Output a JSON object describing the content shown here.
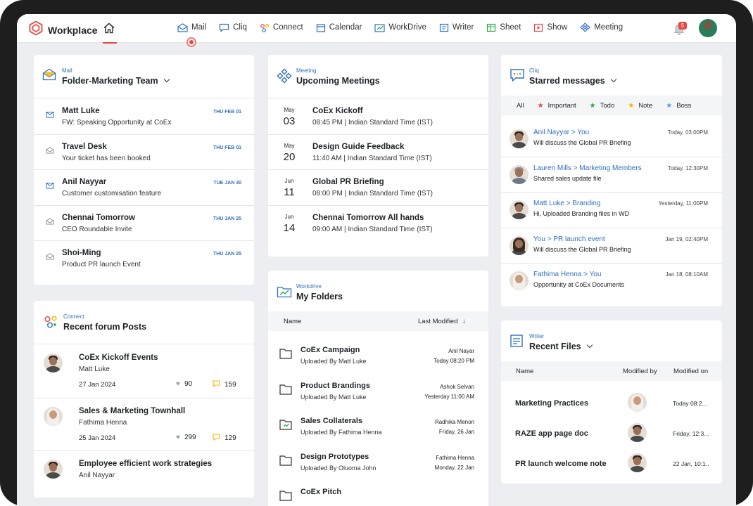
{
  "app": {
    "name": "Workplace",
    "notifications": "5"
  },
  "nav": {
    "items": [
      {
        "label": "Mail",
        "icon": "mail-icon"
      },
      {
        "label": "Cliq",
        "icon": "chat-icon"
      },
      {
        "label": "Connect",
        "icon": "connect-icon"
      },
      {
        "label": "Calendar",
        "icon": "calendar-icon"
      },
      {
        "label": "WorkDrive",
        "icon": "workdrive-icon"
      },
      {
        "label": "Writer",
        "icon": "writer-icon"
      },
      {
        "label": "Sheet",
        "icon": "sheet-icon"
      },
      {
        "label": "Show",
        "icon": "show-icon"
      },
      {
        "label": "Meeting",
        "icon": "meeting-icon"
      }
    ]
  },
  "mail": {
    "app_label": "Mail",
    "title": "Folder-Marketing Team",
    "items": [
      {
        "sender": "Matt Luke",
        "subject": "FW: Speaking Opportunity at CoEx",
        "date": "THU FEB 01",
        "read": false
      },
      {
        "sender": "Travel Desk",
        "subject": "Your ticket has been booked",
        "date": "THU FEB 01",
        "read": true
      },
      {
        "sender": "Anil Nayyar",
        "subject": "Customer customisation feature",
        "date": "TUE JAN 30",
        "read": false
      },
      {
        "sender": "Chennai Tomorrow",
        "subject": "CEO Roundable Invite",
        "date": "THU JAN 25",
        "read": true
      },
      {
        "sender": "Shoi-Ming",
        "subject": "Product PR launch Event",
        "date": "THU JAN 25",
        "read": true
      }
    ]
  },
  "meeting": {
    "app_label": "Meeting",
    "title": "Upcoming Meetings",
    "items": [
      {
        "month": "May",
        "day": "03",
        "title": "CoEx Kickoff",
        "time": "08:45 PM | Indian Standard Time (IST)"
      },
      {
        "month": "May",
        "day": "20",
        "title": "Design Guide Feedback",
        "time": "11:40 AM | Indian Standard Time (IST)"
      },
      {
        "month": "Jun",
        "day": "11",
        "title": "Global PR Briefing",
        "time": "08:00 PM | Indian Standard Time (IST)"
      },
      {
        "month": "Jun",
        "day": "14",
        "title": "Chennai Tomorrow All hands",
        "time": "09:00 AM | Indian Standard Time (IST)"
      }
    ]
  },
  "cliq": {
    "app_label": "Cliq",
    "title": "Starred messages",
    "filters": [
      {
        "label": "All",
        "color": ""
      },
      {
        "label": "Important",
        "color": "#e5483f"
      },
      {
        "label": "Todo",
        "color": "#2aa84a"
      },
      {
        "label": "Note",
        "color": "#f4b400"
      },
      {
        "label": "Boss",
        "color": "#4aa3e0"
      }
    ],
    "messages": [
      {
        "from": "Anil Nayyar > You",
        "text": "Will discuss the Global PR Briefing",
        "time": "Today, 03:00PM"
      },
      {
        "from": "Lauren Mills > Marketing Members",
        "text": "Shared sales update file",
        "time": "Today, 12:30PM"
      },
      {
        "from": "Matt Luke > Branding",
        "text": "Hi, Uploaded Branding files in WD",
        "time": "Yesterday, 11:00PM"
      },
      {
        "from": "You > PR launch event",
        "text": "Will discuss the Global PR Briefing",
        "time": "Jan 19, 02:40PM"
      },
      {
        "from": "Fathima Henna > You",
        "text": "Opportunity at CoEx Documents",
        "time": "Jan 18, 08:10AM"
      }
    ]
  },
  "connect": {
    "app_label": "Connect",
    "title": "Recent forum Posts",
    "posts": [
      {
        "title": "CoEx Kickoff Events",
        "author": "Matt Luke",
        "date": "27 Jan 2024",
        "likes": "90",
        "comments": "159"
      },
      {
        "title": "Sales & Marketing Townhall",
        "author": "Fathima Henna",
        "date": "25 Jan 2024",
        "likes": "299",
        "comments": "129"
      },
      {
        "title": "Employee efficient work strategies",
        "author": "Anil Nayyar",
        "date": "",
        "likes": "",
        "comments": ""
      }
    ]
  },
  "workdrive": {
    "app_label": "Workdrive",
    "title": "My Folders",
    "col_name": "Name",
    "col_modified": "Last Modified",
    "items": [
      {
        "name": "CoEx Campaign",
        "uploaded": "Uploaded By Matt Luke",
        "who": "Anil Nayar",
        "when": "Today 08:20 PM"
      },
      {
        "name": "Product Brandings",
        "uploaded": "Uploaded By Matt Luke",
        "who": "Ashok Selvan",
        "when": "Yesterday 11:00 AM"
      },
      {
        "name": "Sales Collaterals",
        "uploaded": "Uploaded By Fathima Henna",
        "who": "Radhika Menon",
        "when": "Friday, 26 Jan"
      },
      {
        "name": "Design Prototypes",
        "uploaded": "Uploaded By Oluoma John",
        "who": "Fathima Henna",
        "when": "Monday, 22 Jan"
      },
      {
        "name": "CoEx Pitch",
        "uploaded": "",
        "who": "",
        "when": ""
      }
    ]
  },
  "writer": {
    "app_label": "Writer",
    "title": "Recent Files",
    "col_name": "Name",
    "col_modified_by": "Modified by",
    "col_modified_on": "Modified on",
    "files": [
      {
        "name": "Marketing Practices",
        "modified_on": "Today 08:2..."
      },
      {
        "name": "RAZE app page doc",
        "modified_on": "Friday, 12:3..."
      },
      {
        "name": "PR launch welcome note",
        "modified_on": "22 Jan, 10:1..."
      }
    ]
  }
}
